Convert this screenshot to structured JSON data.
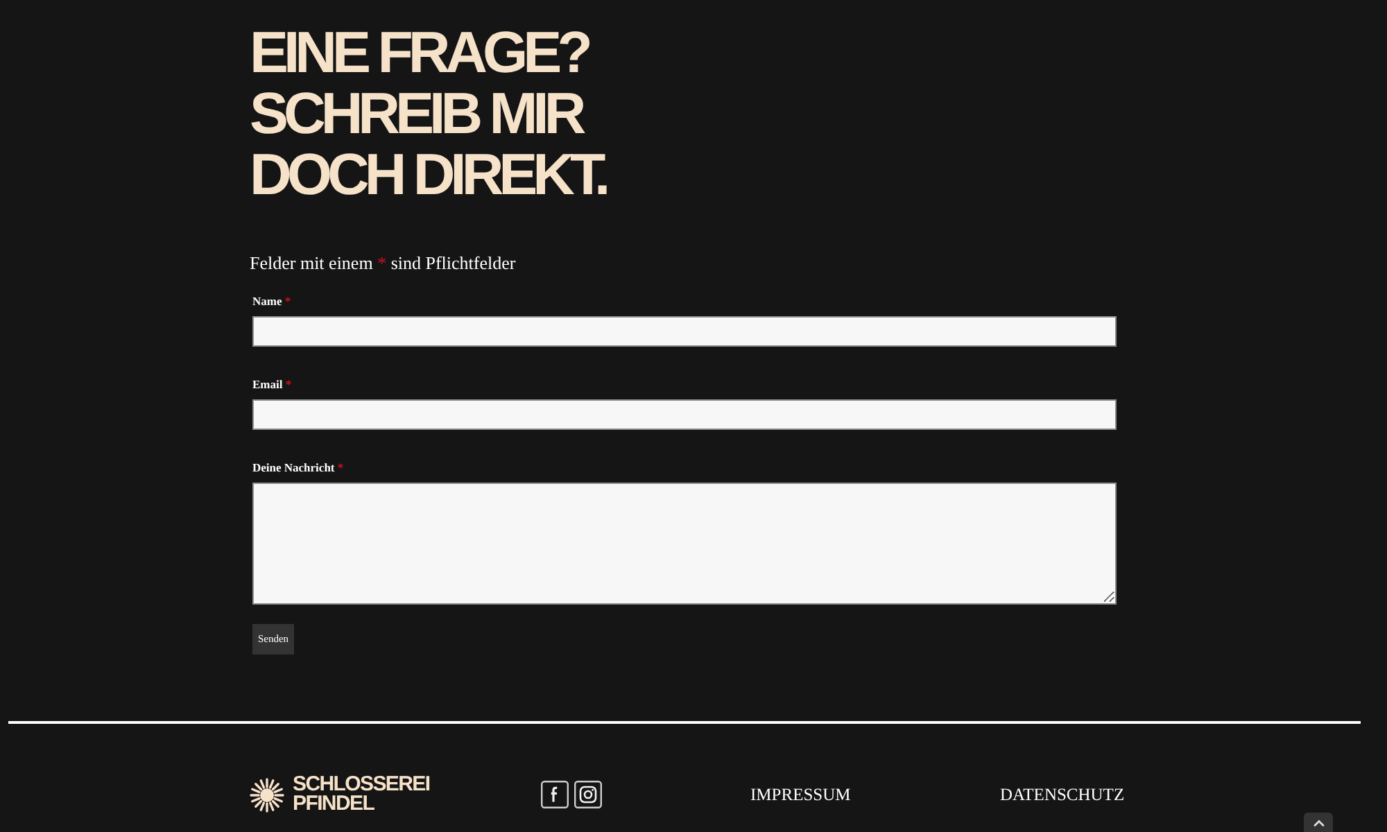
{
  "heading_lines": [
    "EINE FRAGE?",
    "SCHREIB MIR",
    "DOCH DIREKT."
  ],
  "form": {
    "required_note": {
      "text_before": "Felder mit einem",
      "required_mark": "*",
      "text_after": "sind Pflichtfelder"
    },
    "fields": [
      {
        "kind": "input",
        "label": "Name",
        "required_mark": "*"
      },
      {
        "kind": "input",
        "label": "Email",
        "required_mark": "*"
      },
      {
        "kind": "textarea",
        "label": "Deine Nachricht",
        "required_mark": "*"
      }
    ],
    "submit_button": "Senden"
  },
  "footer": {
    "logo_lines": [
      "SCHLOSSEREI",
      "PFINDEL"
    ],
    "links": [
      "IMPRESSUM",
      "DATENSCHUTZ"
    ]
  }
}
